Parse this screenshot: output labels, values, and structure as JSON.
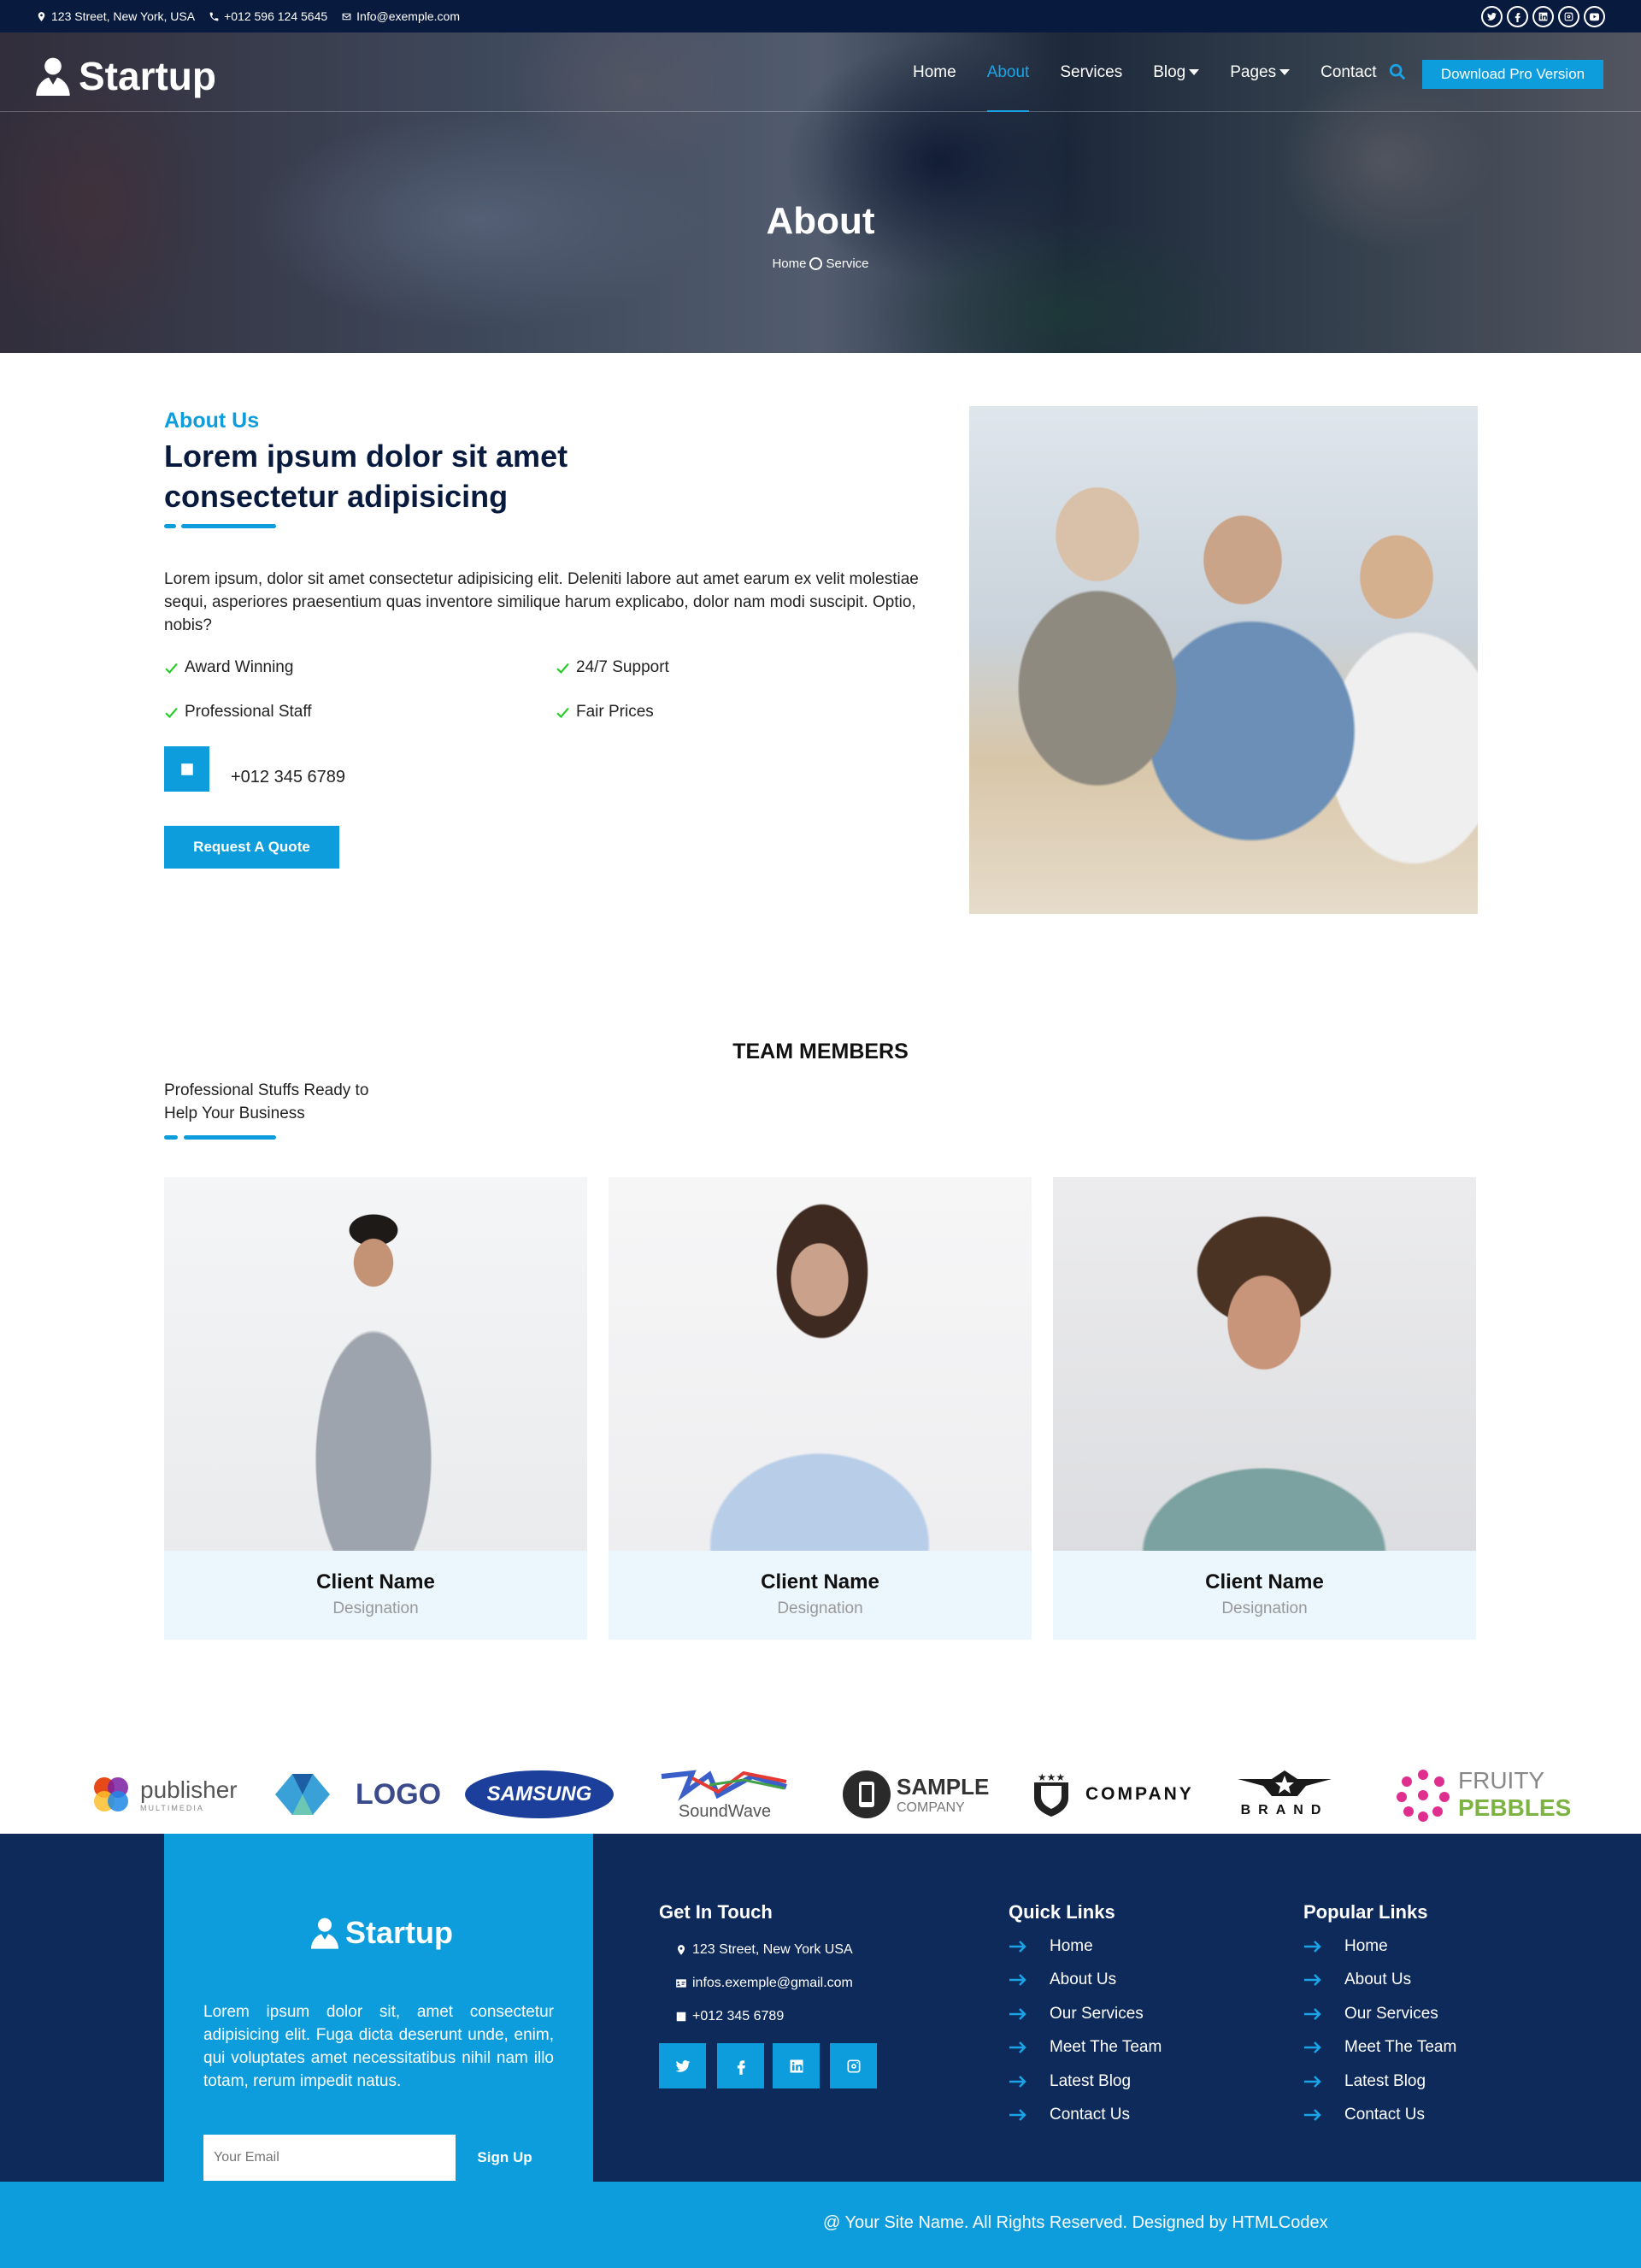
{
  "topbar": {
    "address": "123 Street, New York, USA",
    "phone": "+012 596 124 5645",
    "email": "Info@exemple.com",
    "social_icons": [
      "twitter-icon",
      "facebook-icon",
      "linkedin-icon",
      "instagram-icon",
      "youtube-icon"
    ]
  },
  "nav": {
    "brand": "Startup",
    "items": [
      "Home",
      "About",
      "Services",
      "Blog",
      "Pages",
      "Contact"
    ],
    "active": "About",
    "download_label": "Download Pro Version"
  },
  "hero": {
    "title": "About",
    "crumb_home": "Home",
    "crumb_current": "Service"
  },
  "about": {
    "tag": "About Us",
    "heading": "Lorem ipsum dolor sit amet consectetur adipisicing",
    "paragraph": "Lorem ipsum, dolor sit amet consectetur adipisicing elit. Deleniti labore aut amet earum ex velit molestiae sequi, asperiores praesentium quas inventore similique harum explicabo, dolor nam modi suscipit. Optio, nobis?",
    "features": [
      "Award Winning",
      "24/7 Support",
      "Professional Staff",
      "Fair Prices"
    ],
    "phone": "+012 345 6789",
    "quote_label": "Request A Quote"
  },
  "team": {
    "title": "TEAM MEMBERS",
    "subtitle": "Professional Stuffs Ready to Help Your Business",
    "members": [
      {
        "name": "Client Name",
        "designation": "Designation"
      },
      {
        "name": "Client Name",
        "designation": "Designation"
      },
      {
        "name": "Client Name",
        "designation": "Designation"
      }
    ]
  },
  "partners": [
    {
      "text": "publisher",
      "sub": "MULTIMEDIA"
    },
    {
      "text": "LOGO"
    },
    {
      "text": "SAMSUNG"
    },
    {
      "text": "SoundWave"
    },
    {
      "text": "SAMPLE",
      "sub": "COMPANY"
    },
    {
      "text": "COMPANY"
    },
    {
      "text": "BRAND"
    },
    {
      "text": "FRUITY",
      "sub": "PEBBLES"
    }
  ],
  "footer": {
    "brand": "Startup",
    "description": "Lorem ipsum dolor sit, amet consectetur adipisicing elit. Fuga dicta deserunt unde, enim, qui voluptates amet necessitatibus nihil nam illo totam, rerum impedit natus.",
    "email_placeholder": "Your Email",
    "signup_label": "Sign Up",
    "get_in_touch": {
      "title": "Get In Touch",
      "address": "123 Street, New York USA",
      "email": "infos.exemple@gmail.com",
      "phone": "+012 345 6789"
    },
    "quick_links": {
      "title": "Quick Links",
      "items": [
        "Home",
        "About Us",
        "Our Services",
        "Meet The Team",
        "Latest Blog",
        "Contact Us"
      ]
    },
    "popular_links": {
      "title": "Popular Links",
      "items": [
        "Home",
        "About Us",
        "Our Services",
        "Meet The Team",
        "Latest Blog",
        "Contact Us"
      ]
    },
    "copyright": "@ Your Site Name. All Rights Reserved. Designed by HTMLCodex"
  },
  "colors": {
    "navy": "#081a3d",
    "accent": "#0d9ddc",
    "footer": "#0d2a5b",
    "check": "#22cc22"
  }
}
